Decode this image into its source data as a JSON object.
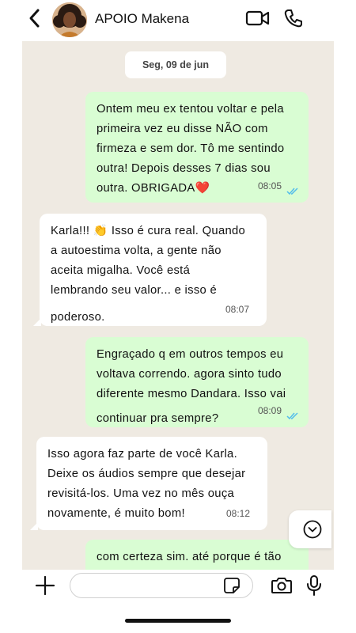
{
  "header": {
    "title": "APOIO Makena",
    "icons": {
      "back": "chevron-left-icon",
      "avatar": "avatar",
      "video": "video-camera-icon",
      "call": "phone-icon"
    }
  },
  "chat": {
    "date_label": "Seg, 09 de jun",
    "messages": [
      {
        "direction": "out",
        "lines": [
          "Ontem meu ex tentou voltar e pela",
          "primeira vez eu disse NÃO com",
          "firmeza e sem dor. Tô me sentindo",
          "outra! Depois desses 7 dias sou",
          "outra. OBRIGADA❤️"
        ],
        "time": "08:05",
        "read": true
      },
      {
        "direction": "in",
        "lines": [
          "Karla!!! 👏 Isso é cura real. Quando",
          "a autoestima volta, a gente não",
          "aceita migalha. Você está",
          "lembrando seu valor... e isso é",
          "poderoso."
        ],
        "time": "08:07"
      },
      {
        "direction": "out",
        "lines": [
          "Engraçado q em outros tempos eu",
          "voltava correndo. agora sinto tudo",
          "diferente mesmo Dandara. Isso vai",
          "continuar pra sempre?"
        ],
        "time": "08:09",
        "read": true
      },
      {
        "direction": "in",
        "lines": [
          "Isso agora faz parte de você Karla.",
          "Deixe os áudios sempre que desejar",
          "revisitá-los. Uma vez no mês ouça",
          "novamente, é muito bom!"
        ],
        "time": "08:12"
      },
      {
        "direction": "out",
        "lines": [
          "com certeza sim. até porque é tão"
        ],
        "time": ""
      }
    ]
  },
  "composer": {
    "placeholder": "",
    "icons": {
      "add": "plus-icon",
      "sticker": "sticker-icon",
      "camera": "camera-icon",
      "mic": "microphone-icon"
    }
  },
  "colors": {
    "outgoing_bubble": "#d9fdd3",
    "incoming_bubble": "#ffffff",
    "chat_background": "#efeae2",
    "read_ticks": "#53bdeb"
  }
}
